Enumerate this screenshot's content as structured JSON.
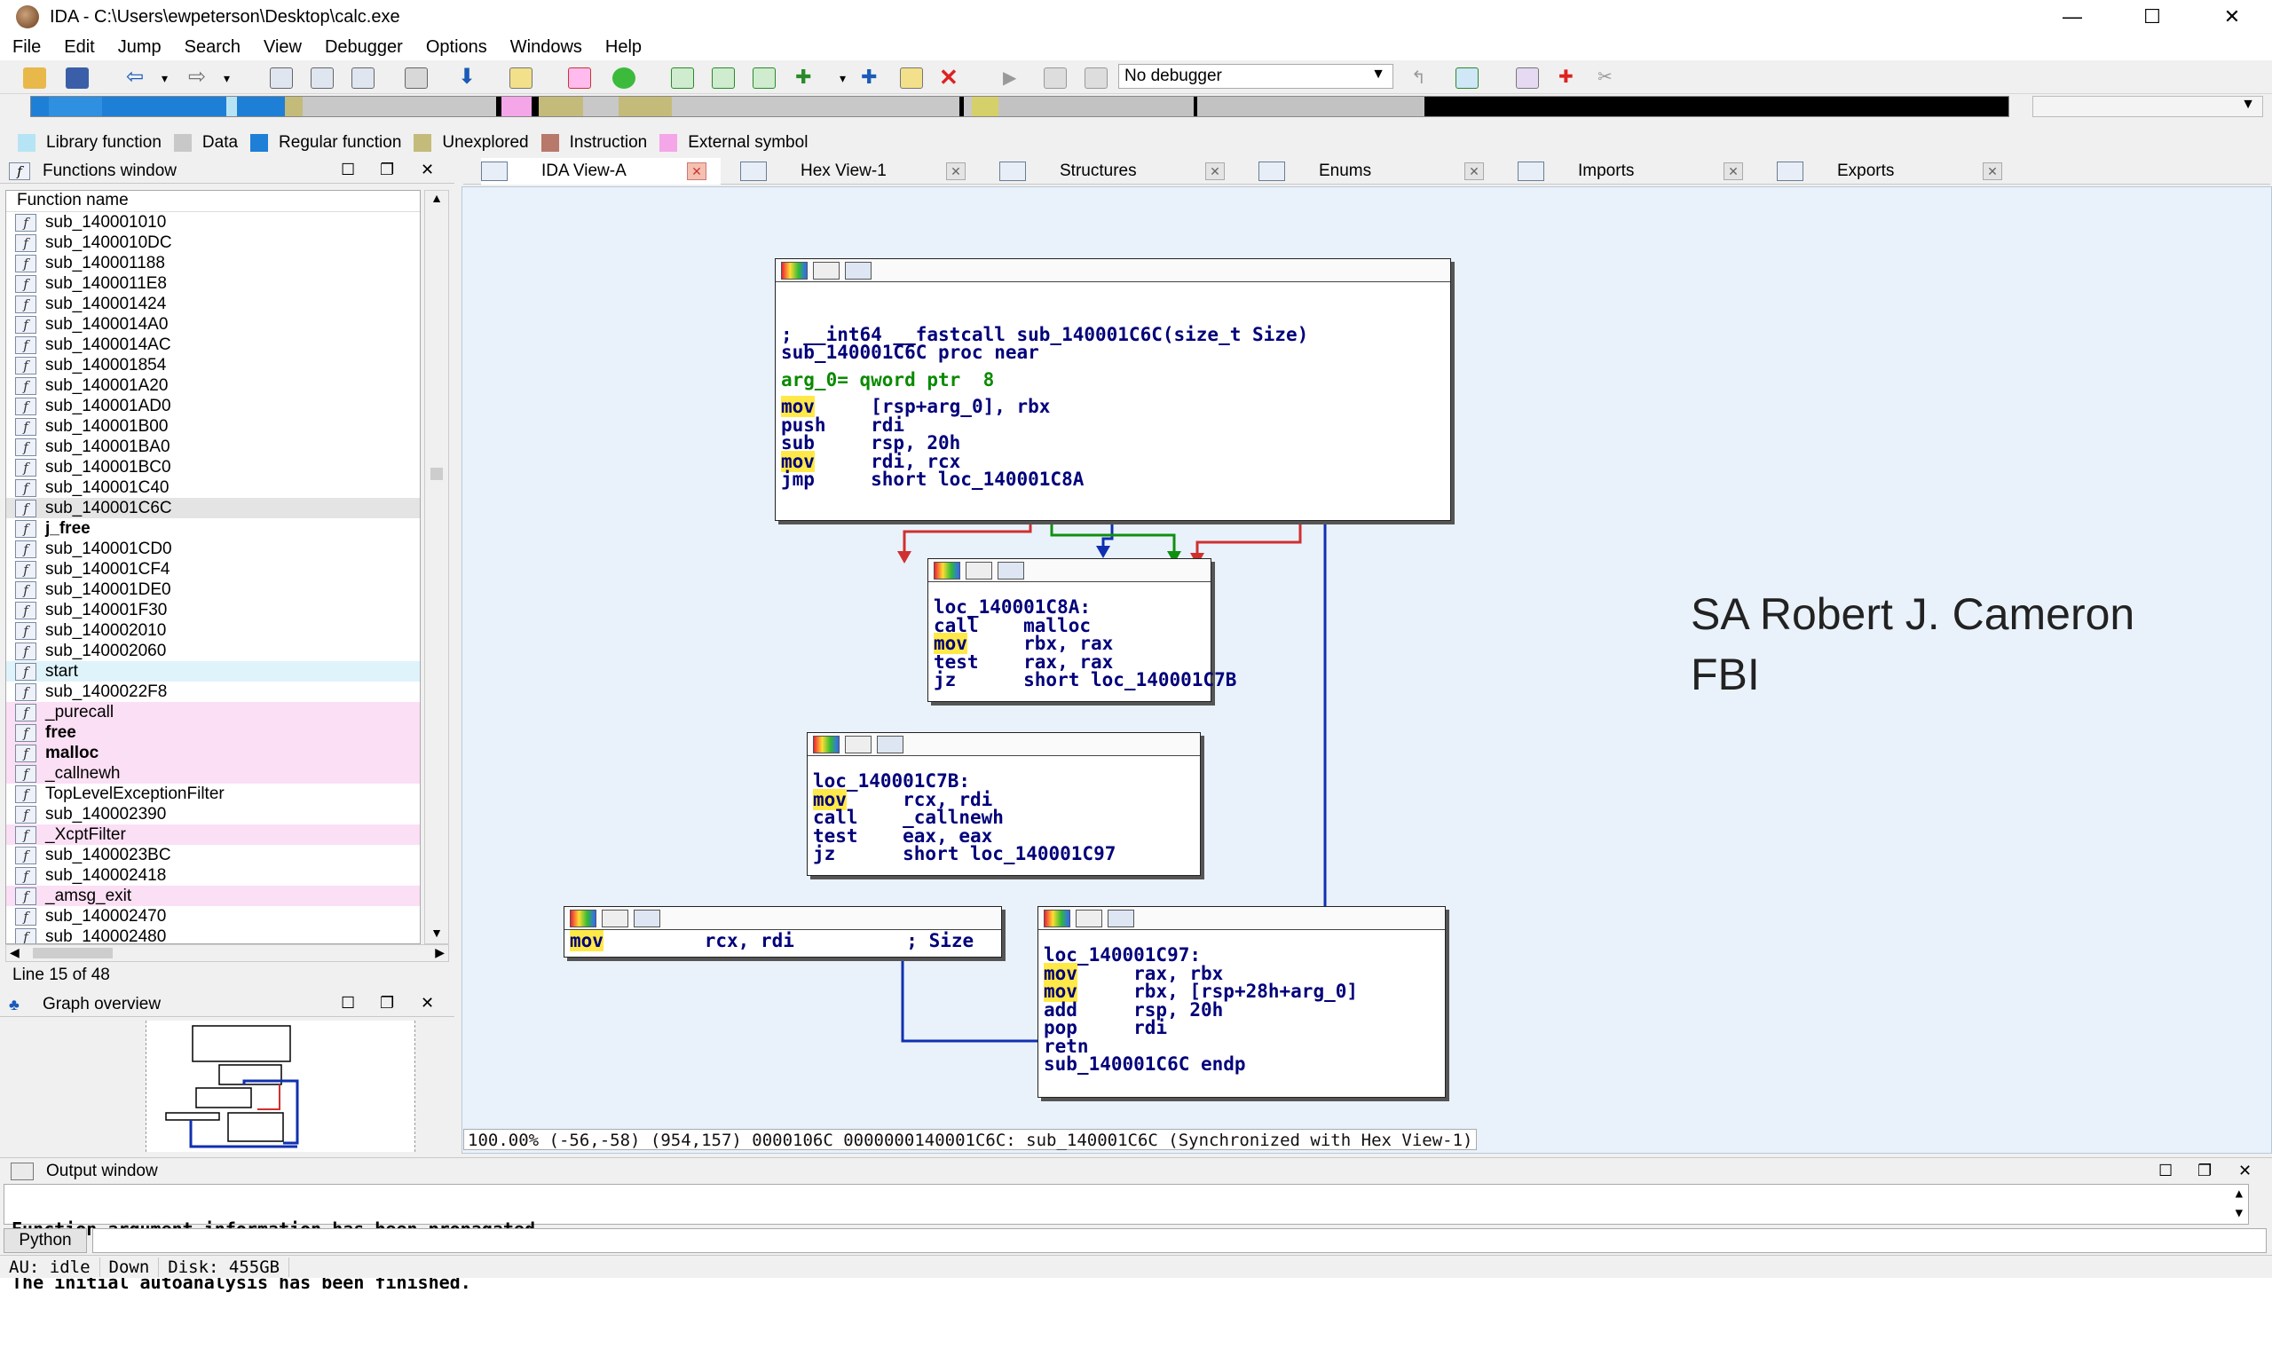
{
  "window": {
    "title": "IDA - C:\\Users\\ewpeterson\\Desktop\\calc.exe",
    "minimize": "—",
    "maximize": "☐",
    "close": "✕"
  },
  "menu": [
    "File",
    "Edit",
    "Jump",
    "Search",
    "View",
    "Debugger",
    "Options",
    "Windows",
    "Help"
  ],
  "toolbar": {
    "debugger_select": "No debugger"
  },
  "legend": [
    {
      "label": "Library function",
      "color": "#b7e4f4"
    },
    {
      "label": "Data",
      "color": "#c8c8c8"
    },
    {
      "label": "Regular function",
      "color": "#1e7fd6"
    },
    {
      "label": "Unexplored",
      "color": "#c4bb7a"
    },
    {
      "label": "Instruction",
      "color": "#b8786a"
    },
    {
      "label": "External symbol",
      "color": "#f4a6e8"
    }
  ],
  "functions_window": {
    "title": "Functions window",
    "column": "Function name",
    "line_info": "Line 15 of 48",
    "items": [
      {
        "name": "sub_140001010",
        "style": ""
      },
      {
        "name": "sub_1400010DC",
        "style": ""
      },
      {
        "name": "sub_140001188",
        "style": ""
      },
      {
        "name": "sub_1400011E8",
        "style": ""
      },
      {
        "name": "sub_140001424",
        "style": ""
      },
      {
        "name": "sub_1400014A0",
        "style": ""
      },
      {
        "name": "sub_1400014AC",
        "style": ""
      },
      {
        "name": "sub_140001854",
        "style": ""
      },
      {
        "name": "sub_140001A20",
        "style": ""
      },
      {
        "name": "sub_140001AD0",
        "style": ""
      },
      {
        "name": "sub_140001B00",
        "style": ""
      },
      {
        "name": "sub_140001BA0",
        "style": ""
      },
      {
        "name": "sub_140001BC0",
        "style": ""
      },
      {
        "name": "sub_140001C40",
        "style": ""
      },
      {
        "name": "sub_140001C6C",
        "style": "selected"
      },
      {
        "name": "j_free",
        "style": "bold"
      },
      {
        "name": "sub_140001CD0",
        "style": ""
      },
      {
        "name": "sub_140001CF4",
        "style": ""
      },
      {
        "name": "sub_140001DE0",
        "style": ""
      },
      {
        "name": "sub_140001F30",
        "style": ""
      },
      {
        "name": "sub_140002010",
        "style": ""
      },
      {
        "name": "sub_140002060",
        "style": ""
      },
      {
        "name": "start",
        "style": "lib"
      },
      {
        "name": "sub_1400022F8",
        "style": ""
      },
      {
        "name": "_purecall",
        "style": "ext"
      },
      {
        "name": "free",
        "style": "extbold"
      },
      {
        "name": "malloc",
        "style": "extbold"
      },
      {
        "name": "_callnewh",
        "style": "ext"
      },
      {
        "name": "TopLevelExceptionFilter",
        "style": ""
      },
      {
        "name": "sub_140002390",
        "style": ""
      },
      {
        "name": "_XcptFilter",
        "style": "ext"
      },
      {
        "name": "sub_1400023BC",
        "style": ""
      },
      {
        "name": "sub_140002418",
        "style": ""
      },
      {
        "name": "_amsg_exit",
        "style": "ext"
      },
      {
        "name": "sub_140002470",
        "style": ""
      },
      {
        "name": "sub_140002480",
        "style": ""
      }
    ]
  },
  "graph_overview": {
    "title": "Graph overview"
  },
  "tabs": [
    {
      "label": "IDA View-A",
      "active": true
    },
    {
      "label": "Hex View-1",
      "active": false
    },
    {
      "label": "Structures",
      "active": false
    },
    {
      "label": "Enums",
      "active": false
    },
    {
      "label": "Imports",
      "active": false
    },
    {
      "label": "Exports",
      "active": false
    }
  ],
  "nodes": {
    "entry": [
      "; __int64 __fastcall sub_140001C6C(size_t Size)",
      "sub_140001C6C proc near",
      "",
      "arg_0= qword ptr  8",
      "",
      "mov     [rsp+arg_0], rbx",
      "push    rdi",
      "sub     rsp, 20h",
      "mov     rdi, rcx",
      "jmp     short loc_140001C8A"
    ],
    "loop": [
      "loc_140001C8A:",
      "call    malloc",
      "mov     rbx, rax",
      "test    rax, rax",
      "jz      short loc_140001C7B"
    ],
    "check": [
      "loc_140001C7B:",
      "mov     rcx, rdi",
      "call    _callnewh",
      "test    eax, eax",
      "jz      short loc_140001C97"
    ],
    "left": [
      "mov         rcx, rdi          ; Size"
    ],
    "exit": [
      "loc_140001C97:",
      "mov     rax, rbx",
      "mov     rbx, [rsp+28h+arg_0]",
      "add     rsp, 20h",
      "pop     rdi",
      "retn",
      "sub_140001C6C endp"
    ]
  },
  "graph_status": "100.00% (-56,-58) (954,157) 0000106C 0000000140001C6C: sub_140001C6C (Synchronized with Hex View-1)",
  "annotation": {
    "line1": "SA Robert J. Cameron",
    "line2": "FBI"
  },
  "output": {
    "title": "Output window",
    "lines": [
      "Function argument information has been propagated",
      "The initial autoanalysis has been finished."
    ],
    "python_button": "Python"
  },
  "statusbar": {
    "au": "AU:  idle",
    "dir": "Down",
    "disk": "Disk: 455GB"
  }
}
